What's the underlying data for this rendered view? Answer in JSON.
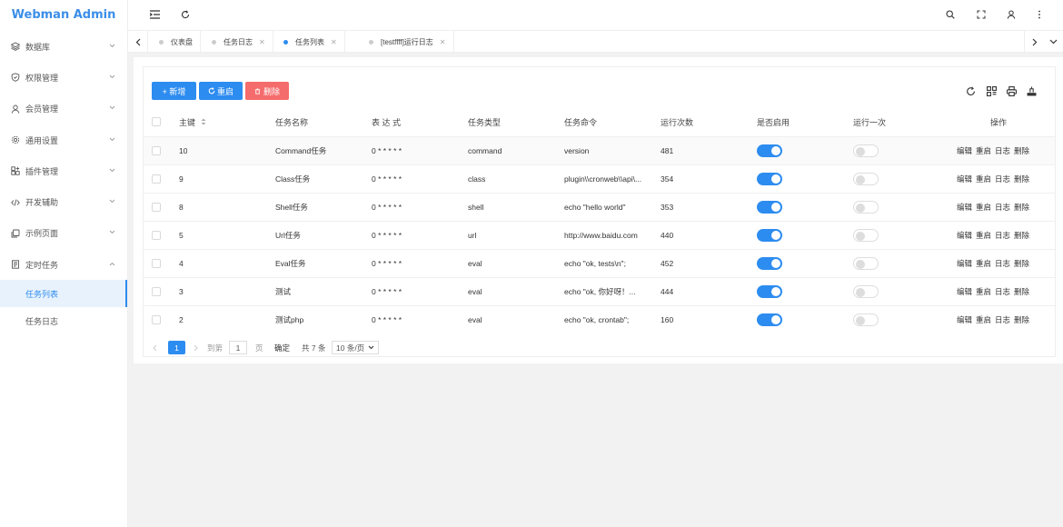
{
  "app": {
    "title": "Webman Admin"
  },
  "sidebar": {
    "items": [
      {
        "label": "数据库",
        "icon": "layers-icon"
      },
      {
        "label": "权限管理",
        "icon": "shield-icon"
      },
      {
        "label": "会员管理",
        "icon": "user-icon"
      },
      {
        "label": "通用设置",
        "icon": "gear-icon"
      },
      {
        "label": "插件管理",
        "icon": "plugin-icon"
      },
      {
        "label": "开发辅助",
        "icon": "code-icon"
      },
      {
        "label": "示例页面",
        "icon": "cards-icon"
      },
      {
        "label": "定时任务",
        "icon": "file-icon"
      }
    ],
    "sub_items": [
      {
        "label": "任务列表",
        "active": true
      },
      {
        "label": "任务日志",
        "active": false
      }
    ]
  },
  "tabs": [
    {
      "label": "仪表盘",
      "closable": false,
      "active": false
    },
    {
      "label": "任务日志",
      "closable": true,
      "active": false
    },
    {
      "label": "任务列表",
      "closable": true,
      "active": true
    },
    {
      "label": "[testffff]运行日志",
      "closable": true,
      "active": false
    }
  ],
  "toolbar": {
    "add_label": "+ 新增",
    "reset_label": "重启",
    "delete_label": "删除"
  },
  "table": {
    "columns": [
      "主键",
      "任务名称",
      "表 达 式",
      "任务类型",
      "任务命令",
      "运行次数",
      "是否启用",
      "运行一次",
      "操作"
    ],
    "actions": [
      "编辑",
      "重启",
      "日志",
      "删除"
    ],
    "rows": [
      {
        "id": "10",
        "name": "Command任务",
        "expr": "0 * * * * *",
        "type": "command",
        "cmd": "version",
        "count": "481",
        "enabled": true,
        "once": false
      },
      {
        "id": "9",
        "name": "Class任务",
        "expr": "0 * * * * *",
        "type": "class",
        "cmd": "plugin\\\\cronweb\\\\api\\...",
        "count": "354",
        "enabled": true,
        "once": false
      },
      {
        "id": "8",
        "name": "Shell任务",
        "expr": "0 * * * * *",
        "type": "shell",
        "cmd": "echo \"hello world\"",
        "count": "353",
        "enabled": true,
        "once": false
      },
      {
        "id": "5",
        "name": "Url任务",
        "expr": "0 * * * * *",
        "type": "url",
        "cmd": "http://www.baidu.com",
        "count": "440",
        "enabled": true,
        "once": false
      },
      {
        "id": "4",
        "name": "Eval任务",
        "expr": "0 * * * * *",
        "type": "eval",
        "cmd": "echo \"ok, tests\\n\";",
        "count": "452",
        "enabled": true,
        "once": false
      },
      {
        "id": "3",
        "name": "测试",
        "expr": "0 * * * * *",
        "type": "eval",
        "cmd": "echo \"ok, 你好呀！...",
        "count": "444",
        "enabled": true,
        "once": false
      },
      {
        "id": "2",
        "name": "测试php",
        "expr": "0 * * * * *",
        "type": "eval",
        "cmd": "echo \"ok, crontab\";",
        "count": "160",
        "enabled": true,
        "once": false
      }
    ]
  },
  "pager": {
    "current": "1",
    "goto_label": "到第",
    "goto_value": "1",
    "page_unit": "页",
    "confirm": "确定",
    "total": "共 7 条",
    "page_size": "10 条/页"
  },
  "colors": {
    "primary": "#2d8cf0",
    "danger": "#f56c6c",
    "logo": "#3b8ee8"
  }
}
